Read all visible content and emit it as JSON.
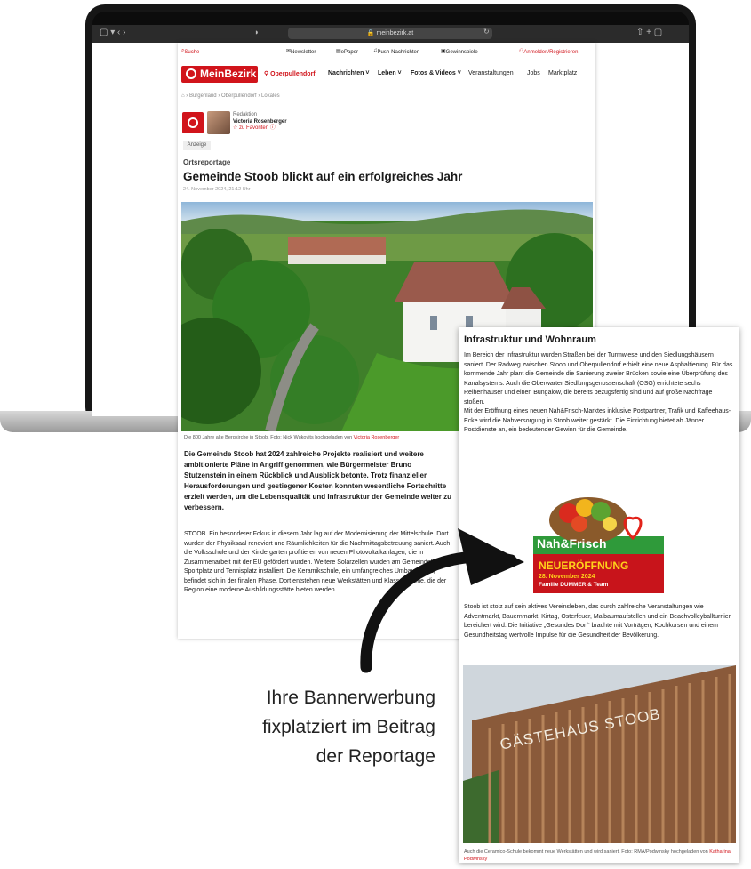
{
  "browser": {
    "url": "meinbezirk.at",
    "tab_controls": "▢ ▾  ‹  ›",
    "right_controls": "⇧  +  ▢"
  },
  "site": {
    "search_label": "Suche",
    "utility": [
      "Newsletter",
      "ePaper",
      "Push-Nachrichten",
      "Gewinnspiele"
    ],
    "login_label": "Anmelden/Registrieren",
    "logo": "MeinBezirk",
    "location": "Oberpullendorf",
    "nav": [
      "Nachrichten ˅",
      "Leben ˅",
      "Fotos & Videos ˅",
      "Veranstaltungen",
      "Jobs",
      "Marktplatz"
    ],
    "breadcrumb": "⌂  ›  Burgenland  ›  Oberpullendorf  ›  Lokales"
  },
  "author": {
    "role": "Redaktion",
    "name": "Victoria Rosenberger",
    "follow": "☆ zu Favoriten  ⓘ"
  },
  "article": {
    "badge": "Anzeige",
    "kicker": "Ortsreportage",
    "headline": "Gemeinde Stoob blickt auf ein erfolgreiches Jahr",
    "date": "24. November 2024, 21:12 Uhr",
    "caption": "Die 800 Jahre alte Bergkirche in Stoob.     Foto: Nick Wukovits     hochgeladen von",
    "caption_author": "Victoria Rosenberger",
    "lead": "Die Gemeinde Stoob hat 2024 zahlreiche Projekte realisiert und weitere ambitionierte Pläne in Angriff genommen, wie Bürgermeister Bruno Stutzenstein in einem Rückblick und Ausblick betonte. Trotz finanzieller Herausforderungen und gestiegener Kosten konnten wesentliche Fortschritte erzielt werden, um die Lebensqualität und Infrastruktur der Gemeinde weiter zu verbessern.",
    "body": "STOOB. Ein besonderer Fokus in diesem Jahr lag auf der Modernisierung der Mittelschule. Dort wurden der Physiksaal renoviert und Räumlichkeiten für die Nachmittagsbetreuung saniert. Auch die Volksschule und der Kindergarten profitieren von neuen Photovoltaikanlagen, die in Zusammenarbeit mit der EU gefördert wurden. Weitere Solarzellen wurden am Gemeindehaus, Sportplatz und Tennisplatz installiert. Die Keramikschule, ein umfangreiches Umbauprojekt, befindet sich in der finalen Phase. Dort entstehen neue Werkstätten und Klassenräume, die der Region eine moderne Ausbildungsstätte bieten werden."
  },
  "card": {
    "heading": "Infrastruktur und Wohnraum",
    "p1": "Im Bereich der Infrastruktur wurden Straßen bei der Turmwiese und den Siedlungshäusern saniert. Der Radweg zwischen Stoob und Oberpullendorf erhielt eine neue Asphaltierung. Für das kommende Jahr plant die Gemeinde die Sanierung zweier Brücken sowie eine Überprüfung des Kanalsystems. Auch die Oberwarter Siedlungsgenossenschaft (OSG) errichtete sechs Reihenhäuser und einen Bungalow, die bereits bezugsfertig sind und auf große Nachfrage stoßen.",
    "p1b": "Mit der Eröffnung eines neuen Nah&Frisch-Marktes inklusive Postpartner, Trafik und Kaffeehaus-Ecke wird die Nahversorgung in Stoob weiter gestärkt. Die Einrichtung bietet ab Jänner Postdienste an, ein bedeutender Gewinn für die Gemeinde.",
    "banner_brand": "Nah&Frisch",
    "banner_title": "NEUERÖFFNUNG",
    "banner_date": "28. November 2024",
    "banner_family": "Familie DUMMER & Team",
    "p2": "Stoob ist stolz auf sein aktives Vereinsleben, das durch zahlreiche Veranstaltungen wie Adventmarkt, Bauernmarkt, Kirtag, Osterfeuer, Maibaumaufstellen und ein Beachvolleyballturnier bereichert wird. Die Initiative „Gesundes Dorf“ brachte mit Vorträgen, Kochkursen und einem Gesundheitstag wertvolle Impulse für die Gesundheit der Bevölkerung.",
    "building_sign": "GÄSTEHAUS STOOB",
    "caption": "Auch die Ceramico-Schule bekommt neue Werkstätten und wird saniert.     Foto: RMA/Podwinsky     hochgeladen von",
    "caption_author": "Katharina Podwinsky"
  },
  "promo": {
    "line1": "Ihre Bannerwerbung",
    "line2": "fixplatziert im Beitrag",
    "line3": "der Reportage"
  },
  "colors": {
    "brand": "#d1141b",
    "banner_green": "#2f9a3a"
  }
}
